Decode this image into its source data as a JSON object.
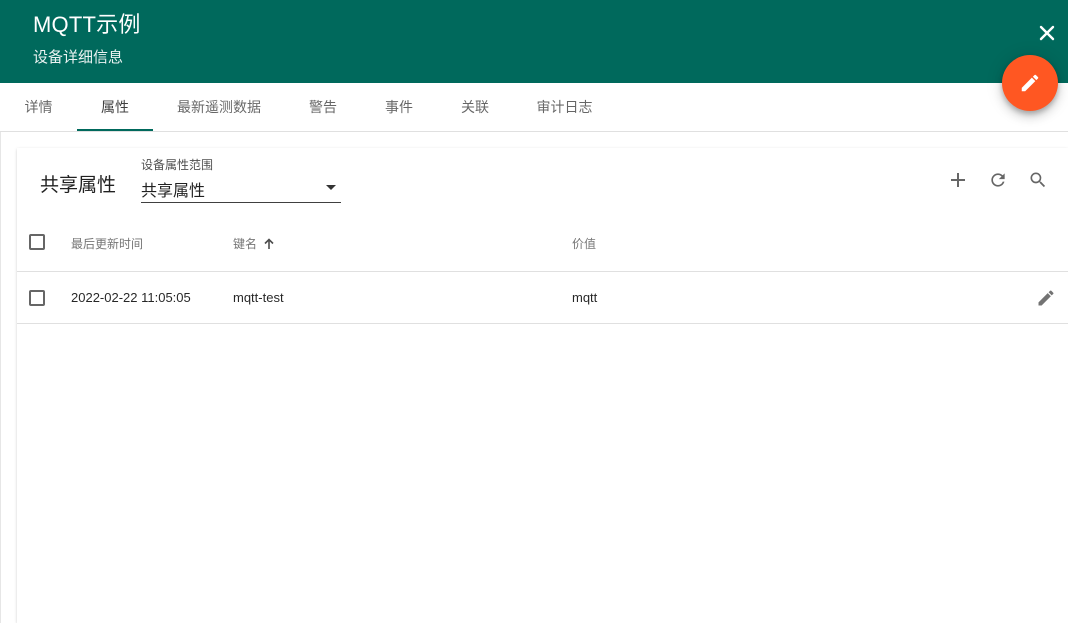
{
  "header": {
    "title": "MQTT示例",
    "subtitle": "设备详细信息",
    "background": "#00695c"
  },
  "fab": {
    "icon": "edit-icon",
    "color": "#ff5722"
  },
  "tabs": [
    {
      "label": "详情",
      "active": false
    },
    {
      "label": "属性",
      "active": true
    },
    {
      "label": "最新遥测数据",
      "active": false
    },
    {
      "label": "警告",
      "active": false
    },
    {
      "label": "事件",
      "active": false
    },
    {
      "label": "关联",
      "active": false
    },
    {
      "label": "审计日志",
      "active": false
    }
  ],
  "panel": {
    "title": "共享属性",
    "scope": {
      "label": "设备属性范围",
      "value": "共享属性"
    },
    "toolbar": {
      "add_icon": "add-icon",
      "refresh_icon": "refresh-icon",
      "search_icon": "search-icon"
    }
  },
  "table": {
    "columns": {
      "updated": "最后更新时间",
      "key": "键名",
      "value": "价值"
    },
    "sort": {
      "column": "key",
      "direction": "ascending"
    },
    "rows": [
      {
        "updated": "2022-02-22 11:05:05",
        "key": "mqtt-test",
        "value": "mqtt"
      }
    ]
  }
}
